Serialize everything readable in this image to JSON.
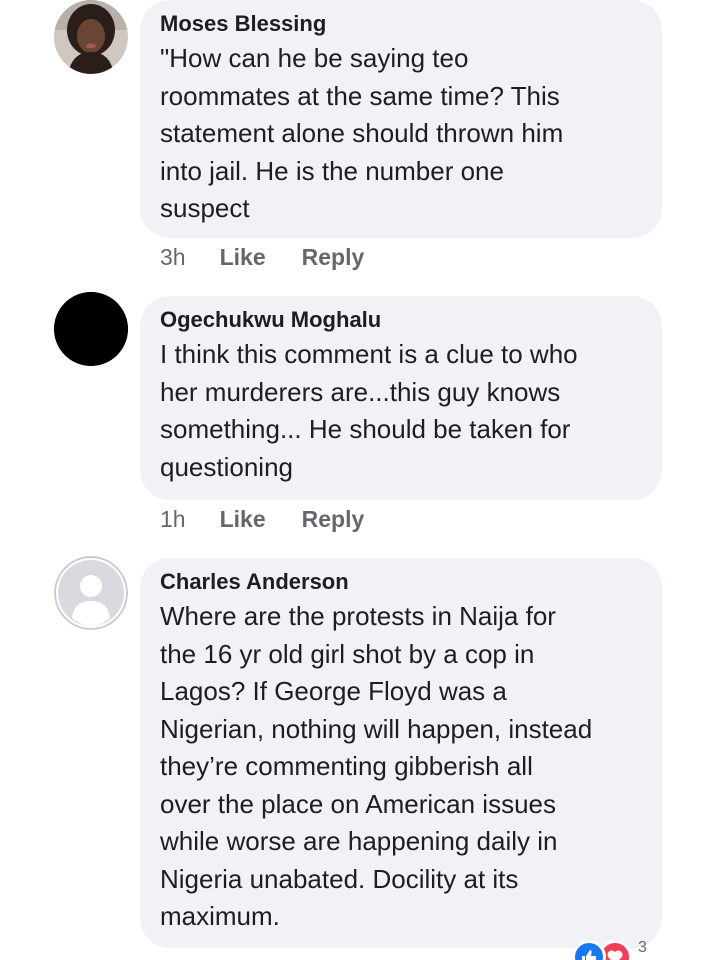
{
  "comments": [
    {
      "author": "Moses Blessing",
      "text": "\"How can he be saying teo\nroommates at the same time? This\nstatement alone should thrown him\ninto jail. He is the number one\nsuspect",
      "time": "3h",
      "like_label": "Like",
      "reply_label": "Reply",
      "avatar_icon": "profile-photo"
    },
    {
      "author": "Ogechukwu Moghalu",
      "text": "I think this comment is a clue to who\nher murderers are...this guy knows\nsomething... He should be taken for\nquestioning",
      "time": "1h",
      "like_label": "Like",
      "reply_label": "Reply",
      "avatar_icon": "black-circle-avatar"
    },
    {
      "author": "Charles Anderson",
      "text": "Where are the protests in Naija for\nthe 16 yr old girl shot by a cop in\nLagos? If George Floyd was a\nNigerian, nothing will happen, instead\nthey’re commenting gibberish all\nover the place on American issues\nwhile worse are happening daily in\nNigeria unabated. Docility at its\nmaximum.",
      "avatar_icon": "default-user-silhouette"
    }
  ],
  "reactions": {
    "icons": [
      "like-icon",
      "love-icon"
    ],
    "count": "3"
  },
  "colors": {
    "bubble": "#f0f2f5",
    "text": "#1c1e21",
    "meta": "#65676b",
    "like_blue": "#1877f2",
    "love_red": "#f33e58"
  }
}
